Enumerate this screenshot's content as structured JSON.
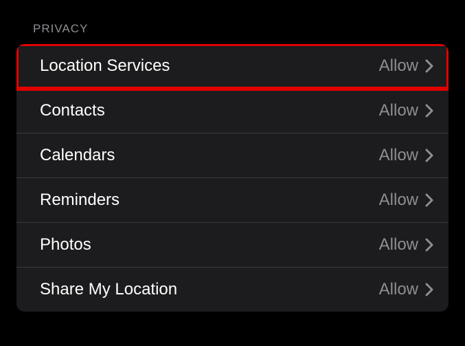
{
  "section": {
    "header": "PRIVACY"
  },
  "rows": [
    {
      "label": "Location Services",
      "value": "Allow",
      "highlight": true
    },
    {
      "label": "Contacts",
      "value": "Allow",
      "highlight": false
    },
    {
      "label": "Calendars",
      "value": "Allow",
      "highlight": false
    },
    {
      "label": "Reminders",
      "value": "Allow",
      "highlight": false
    },
    {
      "label": "Photos",
      "value": "Allow",
      "highlight": false
    },
    {
      "label": "Share My Location",
      "value": "Allow",
      "highlight": false
    }
  ]
}
